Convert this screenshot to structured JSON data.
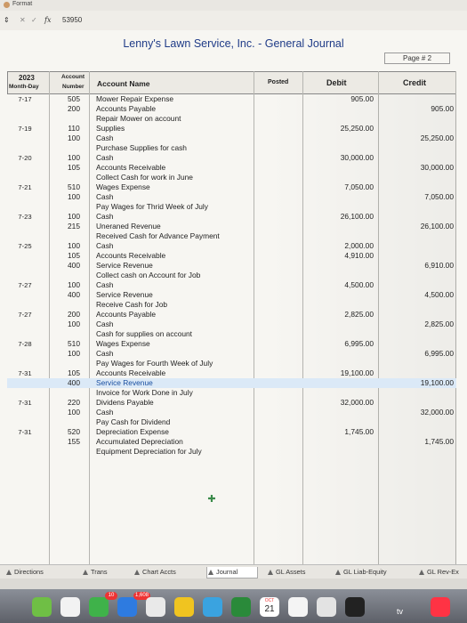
{
  "toolbar": {
    "format_label": "Format"
  },
  "formula_bar": {
    "cancel": "✕",
    "accept": "✓",
    "fx": "fx",
    "value": "53950"
  },
  "sheet": {
    "title": "Lenny's Lawn Service, Inc.  -  General Journal",
    "page": "Page # 2"
  },
  "headers": {
    "year": "2023",
    "month_day": "Month-Day",
    "account": "Account",
    "number": "Number",
    "account_name": "Account Name",
    "posted": "Posted",
    "debit": "Debit",
    "credit": "Credit"
  },
  "rows": [
    {
      "date": "7-17",
      "acct": "505",
      "name": "Mower Repair Expense",
      "debit": "905.00",
      "credit": ""
    },
    {
      "date": "",
      "acct": "200",
      "name": "Accounts Payable",
      "debit": "",
      "credit": "905.00"
    },
    {
      "date": "",
      "acct": "",
      "name": "Repair Mower on account",
      "debit": "",
      "credit": ""
    },
    {
      "date": "7-19",
      "acct": "110",
      "name": "Supplies",
      "debit": "25,250.00",
      "credit": ""
    },
    {
      "date": "",
      "acct": "100",
      "name": "Cash",
      "debit": "",
      "credit": "25,250.00"
    },
    {
      "date": "",
      "acct": "",
      "name": "Purchase Supplies for cash",
      "debit": "",
      "credit": ""
    },
    {
      "date": "7-20",
      "acct": "100",
      "name": "Cash",
      "debit": "30,000.00",
      "credit": ""
    },
    {
      "date": "",
      "acct": "105",
      "name": "Accounts Receivable",
      "debit": "",
      "credit": "30,000.00"
    },
    {
      "date": "",
      "acct": "",
      "name": "Collect Cash for work in June",
      "debit": "",
      "credit": ""
    },
    {
      "date": "7-21",
      "acct": "510",
      "name": "Wages Expense",
      "debit": "7,050.00",
      "credit": ""
    },
    {
      "date": "",
      "acct": "100",
      "name": "Cash",
      "debit": "",
      "credit": "7,050.00"
    },
    {
      "date": "",
      "acct": "",
      "name": "Pay Wages for Thrid Week of July",
      "debit": "",
      "credit": ""
    },
    {
      "date": "7-23",
      "acct": "100",
      "name": "Cash",
      "debit": "26,100.00",
      "credit": ""
    },
    {
      "date": "",
      "acct": "215",
      "name": "Uneraned Revenue",
      "debit": "",
      "credit": "26,100.00"
    },
    {
      "date": "",
      "acct": "",
      "name": "Received Cash for Advance Payment",
      "debit": "",
      "credit": ""
    },
    {
      "date": "7-25",
      "acct": "100",
      "name": "Cash",
      "debit": "2,000.00",
      "credit": ""
    },
    {
      "date": "",
      "acct": "105",
      "name": "Accounts Receivable",
      "debit": "4,910.00",
      "credit": ""
    },
    {
      "date": "",
      "acct": "400",
      "name": "Service Revenue",
      "debit": "",
      "credit": "6,910.00"
    },
    {
      "date": "",
      "acct": "",
      "name": "Collect cash on Account for Job",
      "debit": "",
      "credit": ""
    },
    {
      "date": "7-27",
      "acct": "100",
      "name": "Cash",
      "debit": "4,500.00",
      "credit": ""
    },
    {
      "date": "",
      "acct": "400",
      "name": "Service Revenue",
      "debit": "",
      "credit": "4,500.00"
    },
    {
      "date": "",
      "acct": "",
      "name": "Receive Cash for Job",
      "debit": "",
      "credit": ""
    },
    {
      "date": "7-27",
      "acct": "200",
      "name": "Accounts Payable",
      "debit": "2,825.00",
      "credit": ""
    },
    {
      "date": "",
      "acct": "100",
      "name": "Cash",
      "debit": "",
      "credit": "2,825.00"
    },
    {
      "date": "",
      "acct": "",
      "name": "Cash for supplies on account",
      "debit": "",
      "credit": ""
    },
    {
      "date": "7-28",
      "acct": "510",
      "name": "Wages Expense",
      "debit": "6,995.00",
      "credit": ""
    },
    {
      "date": "",
      "acct": "100",
      "name": "Cash",
      "debit": "",
      "credit": "6,995.00"
    },
    {
      "date": "",
      "acct": "",
      "name": "Pay Wages for Fourth Week of July",
      "debit": "",
      "credit": ""
    },
    {
      "date": "7-31",
      "acct": "105",
      "name": "Accounts Receivable",
      "debit": "19,100.00",
      "credit": ""
    },
    {
      "date": "",
      "acct": "400",
      "name": "Service Revenue",
      "debit": "",
      "credit": "19,100.00"
    },
    {
      "date": "",
      "acct": "",
      "name": "Invoice for Work Done in July",
      "debit": "",
      "credit": ""
    },
    {
      "date": "7-31",
      "acct": "220",
      "name": "Dividens Payable",
      "debit": "32,000.00",
      "credit": ""
    },
    {
      "date": "",
      "acct": "100",
      "name": "Cash",
      "debit": "",
      "credit": "32,000.00"
    },
    {
      "date": "",
      "acct": "",
      "name": "Pay Cash for Dividend",
      "debit": "",
      "credit": ""
    },
    {
      "date": "7-31",
      "acct": "520",
      "name": "Depreciation Expense",
      "debit": "1,745.00",
      "credit": ""
    },
    {
      "date": "",
      "acct": "155",
      "name": "Accumulated Depreciation",
      "debit": "",
      "credit": "1,745.00"
    },
    {
      "date": "",
      "acct": "",
      "name": "Equipment Depreciation for July",
      "debit": "",
      "credit": ""
    }
  ],
  "tabs": [
    {
      "label": "Directions"
    },
    {
      "label": "Trans"
    },
    {
      "label": "Chart Accts"
    },
    {
      "label": "Journal"
    },
    {
      "label": "GL Assets"
    },
    {
      "label": "GL Liab-Equity"
    },
    {
      "label": "GL Rev-Ex"
    }
  ],
  "dock": {
    "badge1": "10",
    "badge2": "1,608",
    "calendar_month": "OCT",
    "calendar_day": "21",
    "tv": "tv"
  }
}
